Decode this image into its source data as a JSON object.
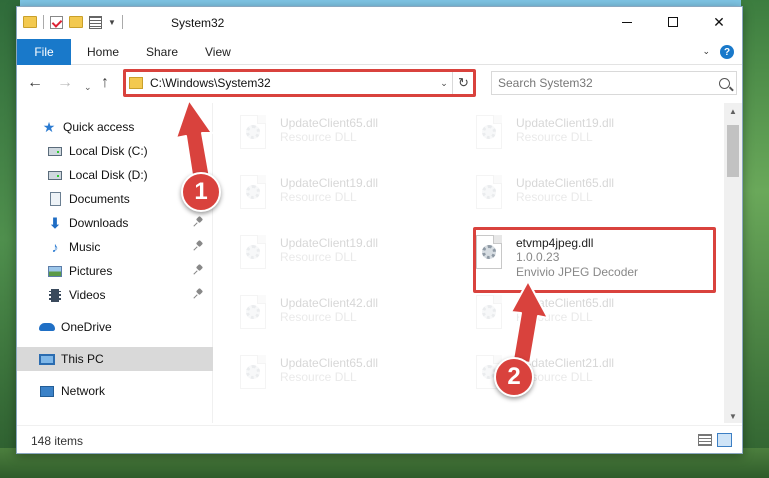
{
  "window": {
    "title": "System32"
  },
  "ribbon": {
    "tabs": [
      "File",
      "Home",
      "Share",
      "View"
    ]
  },
  "address": {
    "path": "C:\\Windows\\System32"
  },
  "search": {
    "placeholder": "Search System32"
  },
  "sidebar": {
    "items": [
      {
        "label": "Quick access",
        "icon": "star-icon",
        "pinned": false
      },
      {
        "label": "Local Disk (C:)",
        "icon": "drive-icon",
        "pinned": true
      },
      {
        "label": "Local Disk (D:)",
        "icon": "drive-icon",
        "pinned": true
      },
      {
        "label": "Documents",
        "icon": "documents-icon",
        "pinned": true
      },
      {
        "label": "Downloads",
        "icon": "download-icon",
        "pinned": true
      },
      {
        "label": "Music",
        "icon": "music-icon",
        "pinned": true
      },
      {
        "label": "Pictures",
        "icon": "pictures-icon",
        "pinned": true
      },
      {
        "label": "Videos",
        "icon": "videos-icon",
        "pinned": true
      },
      {
        "label": "OneDrive",
        "icon": "onedrive-icon",
        "pinned": false
      },
      {
        "label": "This PC",
        "icon": "this-pc-icon",
        "pinned": false,
        "selected": true
      },
      {
        "label": "Network",
        "icon": "network-icon",
        "pinned": false
      }
    ]
  },
  "files": [
    {
      "name": "UpdateClient65.dll",
      "desc": "Resource DLL"
    },
    {
      "name": "UpdateClient19.dll",
      "desc": "Resource DLL"
    },
    {
      "name": "UpdateClient19.dll",
      "desc": "Resource DLL"
    },
    {
      "name": "UpdateClient65.dll",
      "desc": "Resource DLL"
    },
    {
      "name": "UpdateClient19.dll",
      "desc": "Resource DLL"
    },
    {
      "name": "etvmp4jpeg.dll",
      "version": "1.0.0.23",
      "desc": "Envivio JPEG Decoder"
    },
    {
      "name": "UpdateClient42.dll",
      "desc": "Resource DLL"
    },
    {
      "name": "UpdateClient65.dll",
      "desc": "Resource DLL"
    },
    {
      "name": "UpdateClient65.dll",
      "desc": "Resource DLL"
    },
    {
      "name": "UpdateClient21.dll",
      "desc": "Resource DLL"
    }
  ],
  "status": {
    "item_count": "148 items"
  },
  "callouts": {
    "step1": "1",
    "step2": "2"
  },
  "colors": {
    "accent": "#1979ca",
    "callout": "#d9423d",
    "selected": "#d9d9d9"
  }
}
